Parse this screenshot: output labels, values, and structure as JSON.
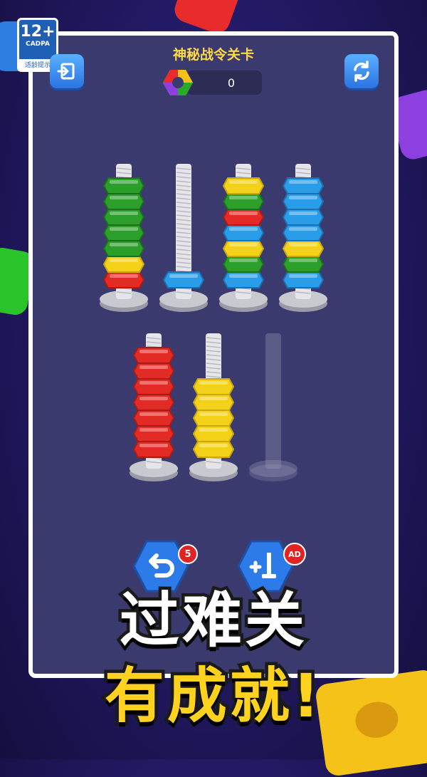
{
  "age_rating": {
    "number": "12+",
    "org": "CADPA",
    "tip": "适龄提示"
  },
  "header": {
    "title": "神秘战令关卡",
    "coin_count": "0"
  },
  "icons": {
    "exit": "exit-icon",
    "restart": "refresh-icon",
    "coin": "hex-nut-coin-icon",
    "undo": "undo-icon",
    "add_rod": "add-rod-icon"
  },
  "colors": {
    "red": "#e42a24",
    "yellow": "#f5d21a",
    "green": "#2c9f2a",
    "blue": "#2a9de8",
    "rod": "#e6e6ea",
    "base": "#c9c9d0"
  },
  "rods_row1": [
    {
      "nuts_bottom_to_top": [
        "red",
        "yellow",
        "green",
        "green",
        "green",
        "green",
        "green"
      ]
    },
    {
      "nuts_bottom_to_top": [
        "blue"
      ]
    },
    {
      "nuts_bottom_to_top": [
        "blue",
        "green",
        "yellow",
        "blue",
        "red",
        "green",
        "yellow"
      ]
    },
    {
      "nuts_bottom_to_top": [
        "blue",
        "green",
        "yellow",
        "blue",
        "blue",
        "blue",
        "blue"
      ]
    }
  ],
  "rods_row2": [
    {
      "nuts_bottom_to_top": [
        "red",
        "red",
        "red",
        "red",
        "red",
        "red",
        "red"
      ]
    },
    {
      "nuts_bottom_to_top": [
        "yellow",
        "yellow",
        "yellow",
        "yellow",
        "yellow"
      ]
    },
    {
      "nuts_bottom_to_top": [],
      "ghost": true
    }
  ],
  "buttons": {
    "undo_badge": "5",
    "add_rod_badge": "AD"
  },
  "slogan": {
    "line1": "过难关",
    "line2": "有成就!"
  }
}
